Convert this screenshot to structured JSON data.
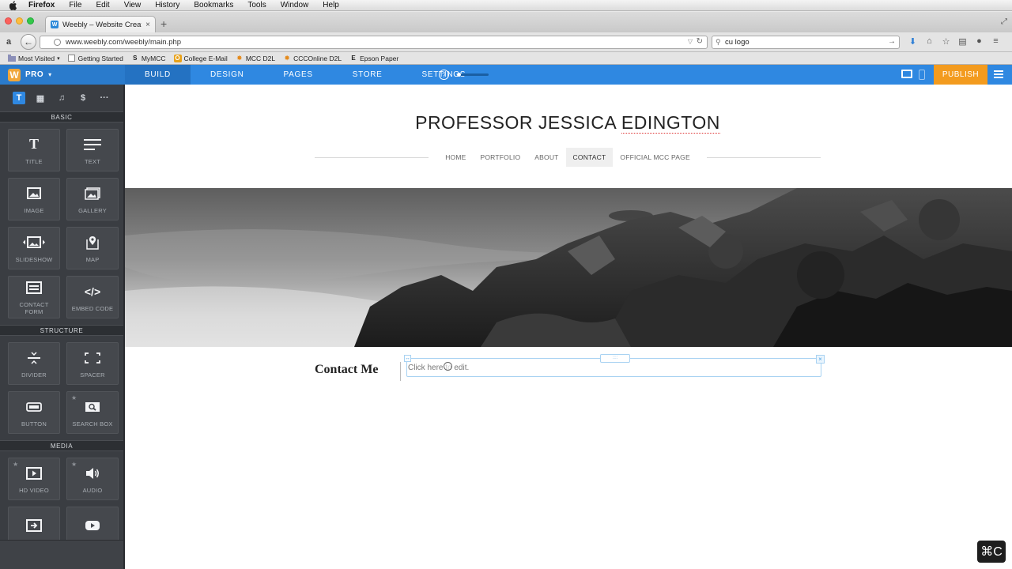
{
  "os_menu": {
    "app": "Firefox",
    "items": [
      "File",
      "Edit",
      "View",
      "History",
      "Bookmarks",
      "Tools",
      "Window",
      "Help"
    ]
  },
  "browser": {
    "tab_title": "Weebly – Website Creation...",
    "tab_favicon": "W",
    "url": "www.weebly.com/weebly/main.php",
    "search_value": "cu logo",
    "bookmarks": [
      {
        "label": "Most Visited",
        "icon": "folder-icon"
      },
      {
        "label": "Getting Started",
        "icon": "page-icon"
      },
      {
        "label": "MyMCC",
        "icon": "S"
      },
      {
        "label": "College E-Mail",
        "icon": "O"
      },
      {
        "label": "MCC D2L",
        "icon": "star-icon"
      },
      {
        "label": "CCCOnline D2L",
        "icon": "star-icon"
      },
      {
        "label": "Epson Paper",
        "icon": "E"
      }
    ]
  },
  "weebly": {
    "logo": "W",
    "plan": "PRO",
    "tabs": [
      "BUILD",
      "DESIGN",
      "PAGES",
      "STORE",
      "SETTINGS"
    ],
    "help": "?",
    "publish": "PUBLISH",
    "accent": "#2f88e1",
    "publish_color": "#f39b1e"
  },
  "sidebar": {
    "tool_icons": [
      "T",
      "▦",
      "♫",
      "$",
      "···"
    ],
    "sections": [
      {
        "title": "BASIC",
        "tiles": [
          {
            "label": "TITLE",
            "icon": "T"
          },
          {
            "label": "TEXT",
            "icon": "☰"
          },
          {
            "label": "IMAGE",
            "icon": "▣"
          },
          {
            "label": "GALLERY",
            "icon": "▤"
          },
          {
            "label": "SLIDESHOW",
            "icon": "◂▣▸"
          },
          {
            "label": "MAP",
            "icon": "⌖"
          },
          {
            "label": "CONTACT\nFORM",
            "icon": "▭"
          },
          {
            "label": "EMBED CODE",
            "icon": "</>"
          }
        ]
      },
      {
        "title": "STRUCTURE",
        "tiles": [
          {
            "label": "DIVIDER",
            "icon": "÷"
          },
          {
            "label": "SPACER",
            "icon": "⬚"
          },
          {
            "label": "BUTTON",
            "icon": "▬"
          },
          {
            "label": "SEARCH BOX",
            "icon": "⌕"
          }
        ]
      },
      {
        "title": "MEDIA",
        "tiles": [
          {
            "label": "HD VIDEO",
            "icon": "▶"
          },
          {
            "label": "AUDIO",
            "icon": "🔊"
          },
          {
            "label": "",
            "icon": "⇥"
          },
          {
            "label": "",
            "icon": "▶"
          }
        ]
      }
    ]
  },
  "site": {
    "title_a": "PROFESSOR JESSICA ",
    "title_b": "EDINGTON",
    "nav": [
      "HOME",
      "PORTFOLIO",
      "ABOUT",
      "CONTACT",
      "OFFICIAL MCC PAGE"
    ],
    "active_nav": "CONTACT",
    "contact_heading": "Contact Me",
    "edit_placeholder": "Click here to edit."
  },
  "keyhint": "⌘C"
}
